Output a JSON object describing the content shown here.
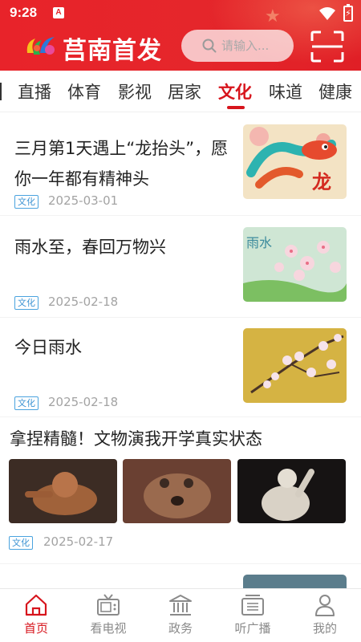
{
  "status": {
    "time": "9:28",
    "notice": "A"
  },
  "header": {
    "app_title": "莒南首发",
    "search_placeholder": "请输入..."
  },
  "categories": {
    "tabs": [
      "直播",
      "体育",
      "影视",
      "居家",
      "文化",
      "味道",
      "健康"
    ],
    "active": "文化"
  },
  "news": [
    {
      "title": "三月第1天遇上“龙抬头”，愿你一年都有精神头",
      "tag": "文化",
      "date": "2025-03-01",
      "thumb_text": "龙"
    },
    {
      "title": "雨水至，春回万物兴",
      "tag": "文化",
      "date": "2025-02-18",
      "thumb_text": "雨水"
    },
    {
      "title": "今日雨水",
      "tag": "文化",
      "date": "2025-02-18"
    }
  ],
  "gallery_article": {
    "title": "拿捏精髓！文物演我开学真实状态",
    "tag": "文化",
    "date": "2025-02-17"
  },
  "bottom_nav": [
    {
      "label": "首页",
      "icon": "home-icon",
      "active": true
    },
    {
      "label": "看电视",
      "icon": "tv-icon",
      "active": false
    },
    {
      "label": "政务",
      "icon": "government-icon",
      "active": false
    },
    {
      "label": "听广播",
      "icon": "radio-icon",
      "active": false
    },
    {
      "label": "我的",
      "icon": "profile-icon",
      "active": false
    }
  ],
  "colors": {
    "brand_red": "#e5262b",
    "active_red": "#d7151d",
    "tag_blue": "#3f94d3",
    "date_gray": "#a3a3a3"
  }
}
